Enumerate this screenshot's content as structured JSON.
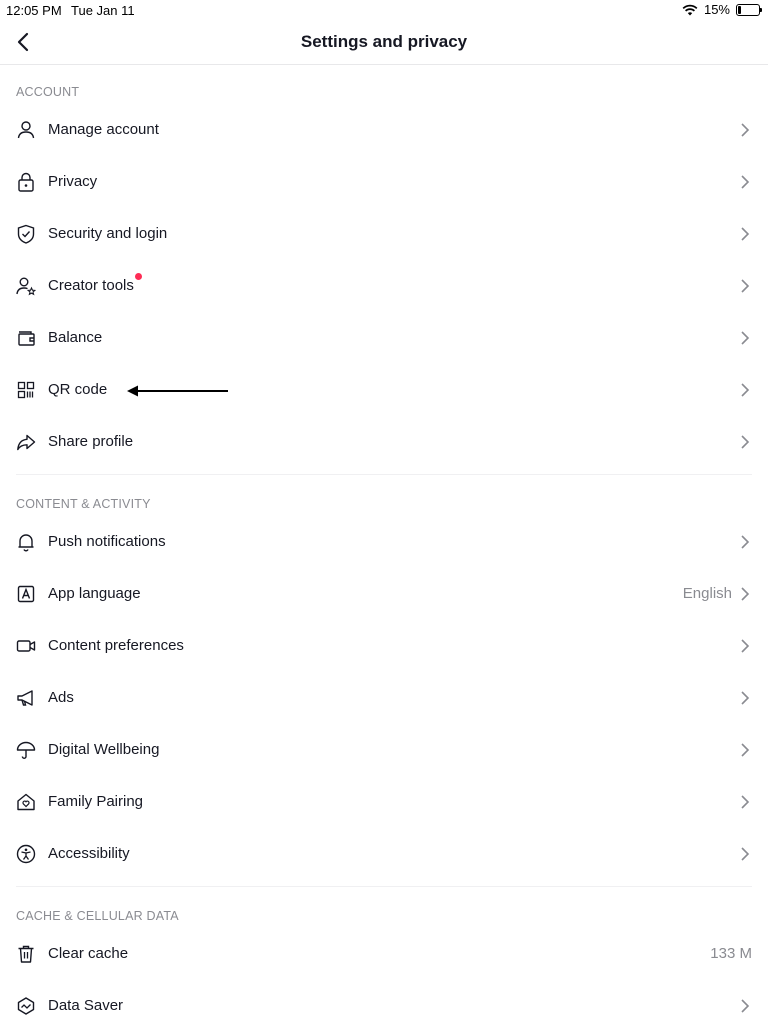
{
  "status_bar": {
    "time": "12:05 PM",
    "date": "Tue Jan 11",
    "battery": "15%",
    "battery_level": 0.15
  },
  "header": {
    "title": "Settings and privacy",
    "back_icon": "chevron-left-icon"
  },
  "sections": {
    "account": {
      "header": "ACCOUNT",
      "items": [
        {
          "label": "Manage account",
          "icon": "person-icon"
        },
        {
          "label": "Privacy",
          "icon": "lock-icon"
        },
        {
          "label": "Security and login",
          "icon": "shield-icon"
        },
        {
          "label": "Creator tools",
          "icon": "person-star-icon",
          "badge": "red-dot"
        },
        {
          "label": "Balance",
          "icon": "wallet-icon"
        },
        {
          "label": "QR code",
          "icon": "qr-code-icon"
        },
        {
          "label": "Share profile",
          "icon": "share-icon"
        }
      ]
    },
    "content": {
      "header": "CONTENT & ACTIVITY",
      "items": [
        {
          "label": "Push notifications",
          "icon": "bell-icon"
        },
        {
          "label": "App language",
          "icon": "language-icon",
          "value": "English"
        },
        {
          "label": "Content preferences",
          "icon": "video-icon"
        },
        {
          "label": "Ads",
          "icon": "megaphone-icon"
        },
        {
          "label": "Digital Wellbeing",
          "icon": "umbrella-icon"
        },
        {
          "label": "Family Pairing",
          "icon": "house-heart-icon"
        },
        {
          "label": "Accessibility",
          "icon": "accessibility-icon"
        }
      ]
    },
    "cache": {
      "header": "CACHE & CELLULAR DATA",
      "items": [
        {
          "label": "Clear cache",
          "icon": "trash-icon",
          "value": "133 M"
        },
        {
          "label": "Data Saver",
          "icon": "data-saver-icon"
        }
      ]
    }
  },
  "colors": {
    "text": "#161823",
    "secondary": "#8a8b91",
    "badge": "#fe2c55",
    "divider": "#f0f0f2"
  }
}
